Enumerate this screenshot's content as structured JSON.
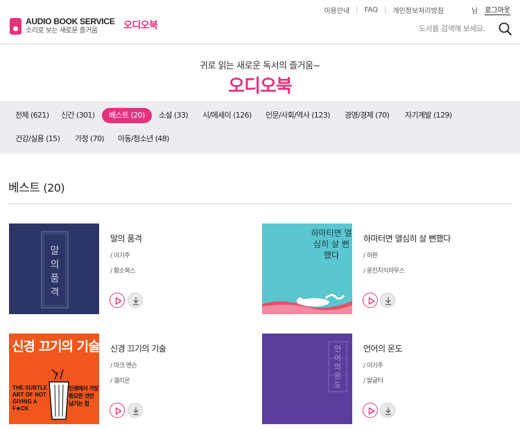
{
  "header": {
    "logo_title": "AUDIO BOOK SERVICE",
    "logo_sub": "소리로 보는 새로운 즐거움",
    "brand_link": "오디오북",
    "util": {
      "guide": "이용안내",
      "faq": "FAQ",
      "privacy": "개인정보처리방침",
      "user": "님",
      "logout": "로그아웃"
    },
    "search_placeholder": "도서를 검색해 보세요."
  },
  "hero": {
    "tagline": "귀로 읽는 새로운 독서의 즐거움~",
    "title": "오디오북"
  },
  "categories": [
    {
      "label": "전체 (621)"
    },
    {
      "label": "신간 (301)"
    },
    {
      "label": "베스트 (20)",
      "active": true
    },
    {
      "label": "소설 (33)"
    },
    {
      "label": "시/에세이 (126)"
    },
    {
      "label": "인문/사회/역사 (123)"
    },
    {
      "label": "경영/경제 (70)"
    },
    {
      "label": "자기계발 (129)"
    },
    {
      "label": "건강/실용 (15)"
    },
    {
      "label": "가정 (70)"
    },
    {
      "label": "아동/청소년 (48)"
    }
  ],
  "section": {
    "title": "베스트",
    "count": "(20)"
  },
  "books": [
    {
      "title": "말의 품격",
      "author": "/ 이기주",
      "publisher": "/ 황소북스",
      "cover_text": "말의 품격",
      "cover_color": "#2c3566"
    },
    {
      "title": "하마터면 열심히 살 뻔했다",
      "author": "/ 하완",
      "publisher": "/ 웅진지식하우스",
      "cover_text": "하마터면 열심히 살 뻔했다",
      "cover_color": "#5ac6cf"
    },
    {
      "title": "신경 끄기의 기술",
      "author": "/ 마크 맨슨",
      "publisher": "/ 갤리온",
      "cover_text": "신경 끄기의 기술",
      "cover_sub_en": [
        "THE SUBTLE",
        "ART OF NOT",
        "GIVING A",
        "F★CK"
      ],
      "cover_sub_ko": [
        "인생에서 가장",
        "중요한 것만",
        "남기는 힘"
      ],
      "cover_color": "#f1561c"
    },
    {
      "title": "언어의 온도",
      "author": "/ 이기주",
      "publisher": "/ 말글터",
      "cover_text": "언어의 온도",
      "cover_color": "#5b3d9e"
    }
  ],
  "colors": {
    "accent": "#e5317e",
    "catbar_bg": "#ecedf1"
  }
}
